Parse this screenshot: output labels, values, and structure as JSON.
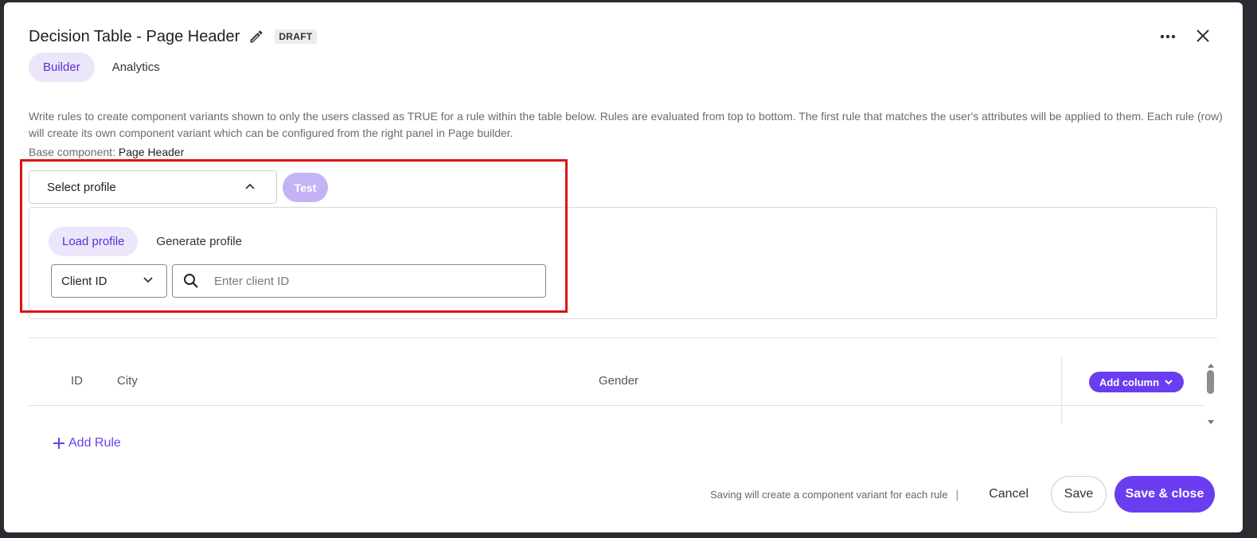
{
  "modal": {
    "title": "Decision Table - Page Header",
    "status_badge": "DRAFT",
    "header_icons": [
      "edit-pencil-icon",
      "more-horizontal-icon",
      "close-icon"
    ]
  },
  "tabs": [
    {
      "label": "Builder",
      "active": true
    },
    {
      "label": "Analytics",
      "active": false
    }
  ],
  "description": "Write rules to create component variants shown to only the users classed as TRUE for a rule within the table below. Rules are evaluated from top to bottom. The first rule that matches the user's attributes will be applied to them. Each rule (row) will create its own component variant which can be configured from the right panel in Page builder.",
  "base_component": {
    "label": "Base component:",
    "value": "Page Header"
  },
  "profile": {
    "select_label": "Select profile",
    "test_label": "Test",
    "subtabs": [
      {
        "label": "Load profile",
        "active": true
      },
      {
        "label": "Generate profile",
        "active": false
      }
    ],
    "id_type": "Client ID",
    "search_placeholder": "Enter client ID",
    "search_value": ""
  },
  "table": {
    "columns": [
      "ID",
      "City",
      "Gender"
    ],
    "add_column_label": "Add column",
    "rows": []
  },
  "add_rule_label": "Add Rule",
  "footer": {
    "note": "Saving will create a component variant for each rule",
    "pipe": "|",
    "cancel_label": "Cancel",
    "save_label": "Save",
    "save_close_label": "Save & close"
  },
  "colors": {
    "accent": "#6a3ef0",
    "accent_soft": "#ece6fb",
    "accent_text": "#5b2fd3",
    "test_disabled": "#c4b3f5",
    "highlight": "#e01010"
  }
}
